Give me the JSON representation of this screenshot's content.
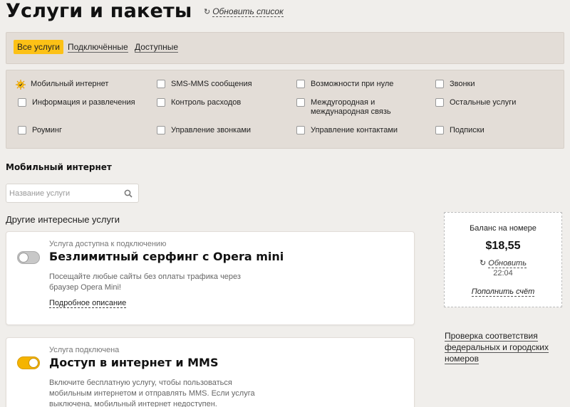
{
  "header": {
    "title": "Услуги и пакеты",
    "refresh_label": "Обновить список"
  },
  "tabs": [
    {
      "label": "Все услуги",
      "active": true
    },
    {
      "label": "Подключённые",
      "active": false
    },
    {
      "label": "Доступные",
      "active": false
    }
  ],
  "categories": [
    {
      "label": "Мобильный интернет",
      "checked": true
    },
    {
      "label": "SMS-MMS сообщения",
      "checked": false
    },
    {
      "label": "Возможности при нуле",
      "checked": false
    },
    {
      "label": "Звонки",
      "checked": false
    },
    {
      "label": "Информация и развлечения",
      "checked": false
    },
    {
      "label": "Контроль расходов",
      "checked": false
    },
    {
      "label": "Междугородная и\nмеждународная связь",
      "checked": false
    },
    {
      "label": "Остальные услуги",
      "checked": false
    },
    {
      "label": "Роуминг",
      "checked": false
    },
    {
      "label": "Управление звонками",
      "checked": false
    },
    {
      "label": "Управление контактами",
      "checked": false
    },
    {
      "label": "Подписки",
      "checked": false
    }
  ],
  "section": {
    "title": "Мобильный интернет",
    "search_placeholder": "Название услуги",
    "other_title": "Другие интересные услуги"
  },
  "services": [
    {
      "status": "Услуга доступна к подключению",
      "title": "Безлимитный серфинг с Opera mini",
      "description": "Посещайте любые сайты без оплаты трафика через браузер Opera Mini!",
      "more_label": "Подробное описание",
      "enabled": false
    },
    {
      "status": "Услуга подключена",
      "title": "Доступ в интернет и MMS",
      "description": "Включите бесплатную услугу, чтобы пользоваться мобильным интернетом и отправлять MMS. Если услуга выключена, мобильный интернет недоступен.",
      "enabled": true
    }
  ],
  "balance": {
    "label": "Баланс на номере",
    "value": "$18,55",
    "refresh_label": "Обновить",
    "time": "22:04",
    "topup_label": "Пополнить счёт"
  },
  "check_link": "Проверка соответствия федеральных и городских номеров",
  "colors": {
    "accent": "#fcc116",
    "toggle_on": "#f5b400",
    "panel_bg": "#e3ddd7"
  }
}
